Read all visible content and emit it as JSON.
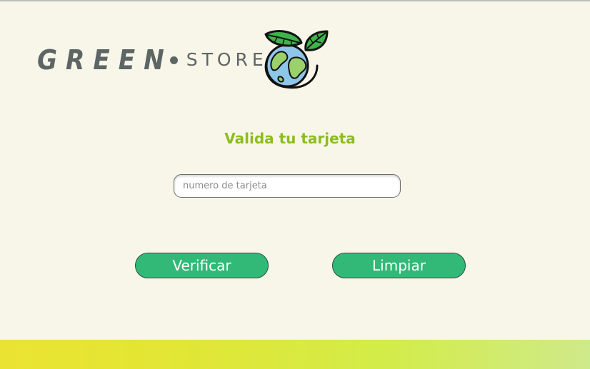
{
  "brand": {
    "name_primary": "GREEN",
    "name_secondary": "STORE",
    "globe_icon": "earth-with-leaves-icon"
  },
  "form": {
    "title": "Valida tu tarjeta",
    "card_number": {
      "value": "",
      "placeholder": "numero de tarjeta"
    },
    "verify_label": "Verificar",
    "clear_label": "Limpiar"
  },
  "colors": {
    "background": "#f8f6e9",
    "title": "#8cbd1e",
    "button": "#32b978",
    "logo_text": "#5d6565",
    "footer_start": "#ebe331",
    "footer_end": "#cfea8a"
  }
}
